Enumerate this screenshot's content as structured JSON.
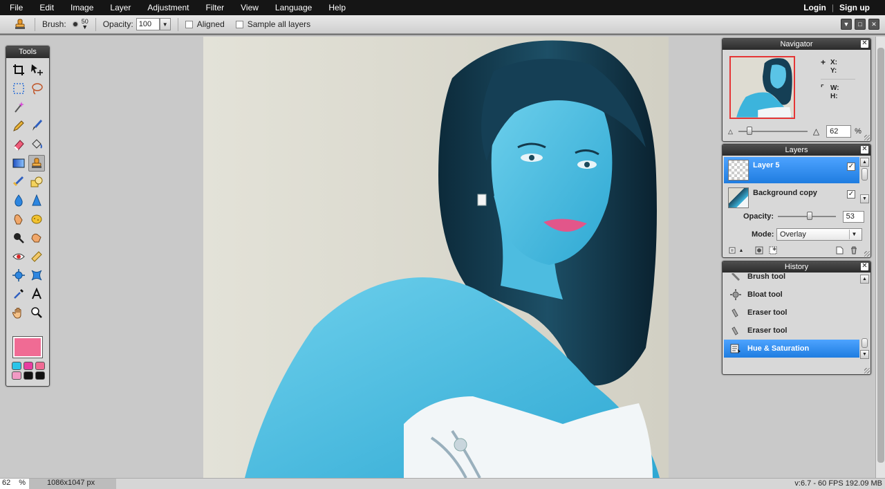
{
  "menubar": {
    "items": [
      "File",
      "Edit",
      "Image",
      "Layer",
      "Adjustment",
      "Filter",
      "View",
      "Language",
      "Help"
    ],
    "login": "Login",
    "separator": "|",
    "signup": "Sign up"
  },
  "options": {
    "tool_icon": "clone-stamp-icon",
    "brush_label": "Brush:",
    "brush_size": "50",
    "opacity_label": "Opacity:",
    "opacity_value": "100",
    "aligned_label": "Aligned",
    "aligned_checked": false,
    "sample_all_label": "Sample all layers",
    "sample_all_checked": false
  },
  "tools": {
    "title": "Tools",
    "foreground_color": "#f06b94",
    "swatches": [
      "#29c4e8",
      "#e83ca0",
      "#f06b94",
      "#f29ac4",
      "#111111",
      "#111111"
    ]
  },
  "navigator": {
    "title": "Navigator",
    "x_label": "X:",
    "y_label": "Y:",
    "w_label": "W:",
    "h_label": "H:",
    "zoom_value": "62",
    "zoom_unit": "%"
  },
  "layers": {
    "title": "Layers",
    "items": [
      {
        "name": "Layer 5",
        "visible": true,
        "selected": true
      },
      {
        "name": "Background copy",
        "visible": true,
        "selected": false
      }
    ],
    "opacity_label": "Opacity:",
    "opacity_value": "53",
    "mode_label": "Mode:",
    "mode_value": "Overlay"
  },
  "history": {
    "title": "History",
    "items": [
      {
        "label": "Brush tool",
        "icon": "brush-icon",
        "selected": false
      },
      {
        "label": "Bloat tool",
        "icon": "bloat-icon",
        "selected": false
      },
      {
        "label": "Eraser tool",
        "icon": "eraser-icon",
        "selected": false
      },
      {
        "label": "Eraser tool",
        "icon": "eraser-icon",
        "selected": false
      },
      {
        "label": "Hue & Saturation",
        "icon": "adjustment-icon",
        "selected": true
      }
    ]
  },
  "status": {
    "zoom": "62",
    "zoom_unit": "%",
    "dimensions": "1086x1047 px",
    "performance": "v:6.7 - 60 FPS 192.09 MB"
  }
}
